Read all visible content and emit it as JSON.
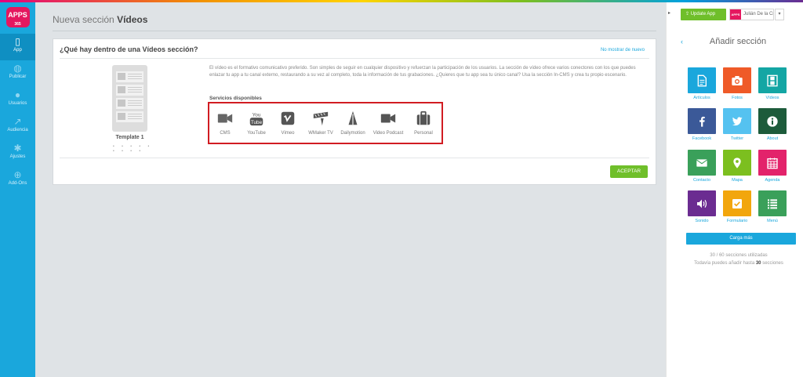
{
  "sidebar": {
    "logo": "APPS",
    "logo_sub": "365",
    "items": [
      {
        "label": "App",
        "icon": "phone-icon"
      },
      {
        "label": "Publicar",
        "icon": "globe-icon"
      },
      {
        "label": "Usuarios",
        "icon": "user-icon"
      },
      {
        "label": "Audiencia",
        "icon": "chart-icon"
      },
      {
        "label": "Ajustes",
        "icon": "gear-icon"
      },
      {
        "label": "Add-Ons",
        "icon": "plus-icon"
      }
    ]
  },
  "header": {
    "title_prefix": "Nueva sección",
    "title_bold": "Vídeos"
  },
  "card": {
    "heading": "¿Qué hay dentro de una Vídeos sección?",
    "no_show": "No mostrar de nuevo",
    "template_label": "Template 1",
    "pager_dots": "• • • • • • • • •",
    "description": "El vídeo es el formativo comunicativo preferido. Son simples de seguir en cualquier dispositivo y refuerzan la participación de los usuarios. La sección de vídeo ofrece varios conectores con los que puedes enlazar tu app a tu canal externo, restaurando a su vez al completo, toda la información de tus grabaciones. ¿Quieres que tu app sea tu único canal? Usa la sección In-CMS y crea tu propio escenario.",
    "servicios_label": "Servicios disponibles",
    "services": [
      {
        "label": "CMS",
        "icon": "video-camera-icon"
      },
      {
        "label": "YouTube",
        "icon": "youtube-icon"
      },
      {
        "label": "Vimeo",
        "icon": "vimeo-icon"
      },
      {
        "label": "WMaker TV",
        "icon": "wmaker-icon"
      },
      {
        "label": "Dailymotion",
        "icon": "dailymotion-icon"
      },
      {
        "label": "Video Podcast",
        "icon": "video-camera-icon"
      },
      {
        "label": "Personal",
        "icon": "briefcase-icon"
      }
    ],
    "accept_label": "ACEPTAR"
  },
  "right_panel": {
    "update_label": "Update App",
    "user_name": "Julián De la Cru",
    "panel_title": "Añadir sección",
    "sections": [
      {
        "label": "Artículos",
        "color": "#1aa7dc",
        "icon": "document-icon"
      },
      {
        "label": "Fotos",
        "color": "#ef5a28",
        "icon": "camera-icon"
      },
      {
        "label": "Vídeos",
        "color": "#14a6a4",
        "icon": "film-icon"
      },
      {
        "label": "Facebook",
        "color": "#3b5998",
        "icon": "facebook-icon"
      },
      {
        "label": "Twitter",
        "color": "#55c2f0",
        "icon": "twitter-icon"
      },
      {
        "label": "About",
        "color": "#1d5b3b",
        "icon": "info-icon"
      },
      {
        "label": "Contacto",
        "color": "#3aa05a",
        "icon": "envelope-icon"
      },
      {
        "label": "Mapa",
        "color": "#7cbf1f",
        "icon": "map-pin-icon"
      },
      {
        "label": "Agenda",
        "color": "#e3236b",
        "icon": "calendar-icon"
      },
      {
        "label": "Sonido",
        "color": "#6b2c91",
        "icon": "speaker-icon"
      },
      {
        "label": "Formulario",
        "color": "#f2a60d",
        "icon": "checkbox-icon"
      },
      {
        "label": "Menú",
        "color": "#3aa05a",
        "icon": "list-icon"
      }
    ],
    "load_more": "Carga más",
    "usage_text": "30 / 60 secciones utilizadas",
    "remaining_prefix": "Todavía puedes añadir hasta",
    "remaining_count": "30",
    "remaining_suffix": "secciones"
  }
}
